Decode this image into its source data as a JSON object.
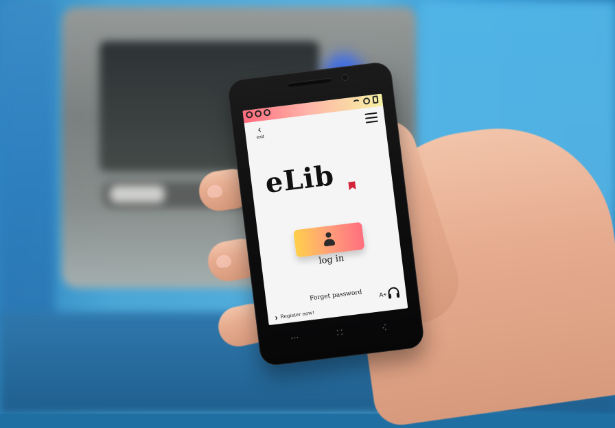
{
  "app": {
    "logo_text": "eLib",
    "back_label": "exit",
    "login_label": "log in",
    "forget_password": "Forget password",
    "register_label": "Register now!",
    "a_plus": "A+"
  },
  "colors": {
    "status_gradient": [
      "#ff6a7c",
      "#ffb3a8",
      "#f6f2a3"
    ],
    "login_gradient": [
      "#ffcf4a",
      "#ff9f7a",
      "#ff6f7e"
    ],
    "accent_ribbon": "#d3253a"
  },
  "icons": {
    "status_left": [
      "status-circle-icon",
      "status-circle-icon",
      "status-circle-icon"
    ],
    "status_right": [
      "wifi-icon",
      "alarm-icon",
      "battery-icon"
    ],
    "back": "back-icon",
    "menu": "menu-icon",
    "login": "user-icon",
    "accessibility": "headset-icon",
    "register": "chevron-right-icon"
  }
}
